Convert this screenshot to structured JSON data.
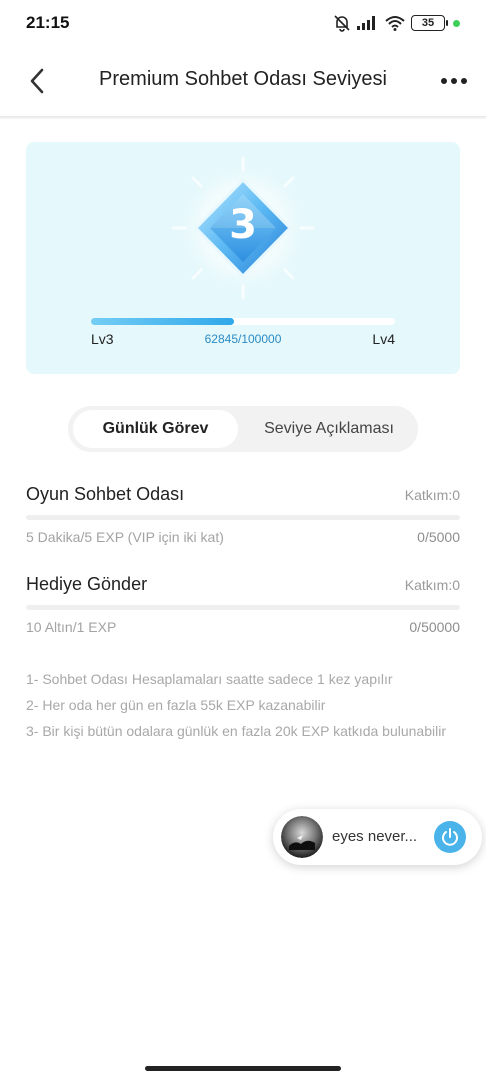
{
  "status_bar": {
    "time": "21:15",
    "battery": "35",
    "icons": [
      "bell-off-icon",
      "signal-icon",
      "wifi-icon",
      "battery-icon",
      "charging-dot-icon"
    ]
  },
  "header": {
    "title": "Premium Sohbet Odası Seviyesi",
    "back_icon": "chevron-left-icon",
    "more_icon": "more-dots-icon"
  },
  "level_card": {
    "badge_number": "3",
    "current_level": "Lv3",
    "next_level": "Lv4",
    "exp_text": "62845/100000",
    "progress_fraction": 0.47,
    "accent_color": "#2fa8ea"
  },
  "tabs": [
    {
      "label": "Günlük Görev",
      "active": true
    },
    {
      "label": "Seviye Açıklaması",
      "active": false
    }
  ],
  "tasks": [
    {
      "title": "Oyun Sohbet Odası",
      "katkim": "Katkım:0",
      "description": "5 Dakika/5 EXP (VIP için iki kat)",
      "count": "0/5000",
      "progress_fraction": 0
    },
    {
      "title": "Hediye Gönder",
      "katkim": "Katkım:0",
      "description": "10 Altın/1 EXP",
      "count": "0/50000",
      "progress_fraction": 0
    }
  ],
  "notes": [
    "1- Sohbet Odası Hesaplamaları saatte sadece 1 kez yapılır",
    "2- Her oda her gün en fazla 55k EXP kazanabilir",
    "3- Bir kişi bütün odalara günlük en fazla 20k EXP katkıda bulunabilir"
  ],
  "floating_player": {
    "title": "eyes never...",
    "power_icon": "power-icon",
    "accent_color": "#4ab3ea"
  }
}
